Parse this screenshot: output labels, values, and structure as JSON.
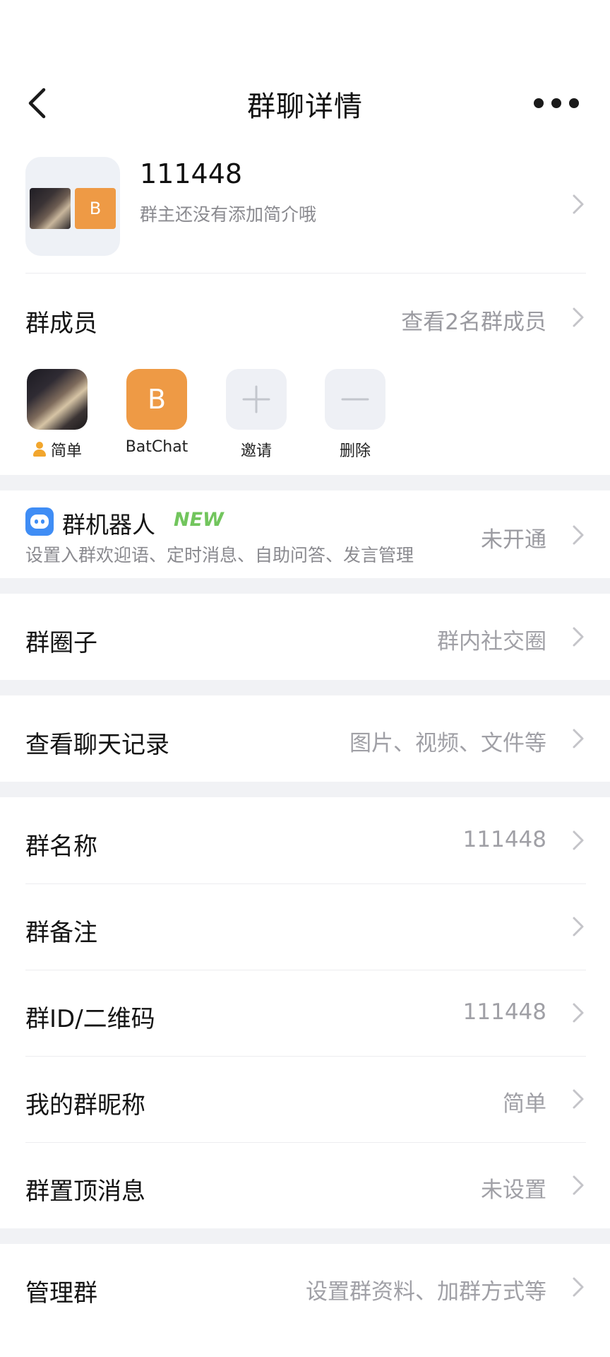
{
  "nav": {
    "title": "群聊详情"
  },
  "group": {
    "name": "111448",
    "intro": "群主还没有添加简介哦",
    "avatar_letter": "B"
  },
  "members": {
    "label": "群成员",
    "view_all": "查看2名群成员",
    "list": [
      {
        "name": "简单"
      },
      {
        "name": "BatChat",
        "letter": "B"
      }
    ],
    "invite_label": "邀请",
    "delete_label": "删除"
  },
  "robot": {
    "title": "群机器人",
    "badge": "NEW",
    "desc": "设置入群欢迎语、定时消息、自助问答、发言管理",
    "status": "未开通"
  },
  "circle": {
    "label": "群圈子",
    "value": "群内社交圈"
  },
  "history": {
    "label": "查看聊天记录",
    "value": "图片、视频、文件等"
  },
  "settings": [
    {
      "label": "群名称",
      "value": "111448"
    },
    {
      "label": "群备注",
      "value": ""
    },
    {
      "label": "群ID/二维码",
      "value": "111448"
    },
    {
      "label": "我的群昵称",
      "value": "简单"
    },
    {
      "label": "群置顶消息",
      "value": "未设置"
    }
  ],
  "manage": {
    "label": "管理群",
    "value": "设置群资料、加群方式等"
  },
  "colors": {
    "accent_orange": "#ee9a45",
    "new_green": "#72c55d",
    "robot_blue": "#3f8df5",
    "divider_bg": "#f1f2f5"
  },
  "icons": [
    "back-icon",
    "more-icon",
    "chevron-right-icon",
    "person-icon",
    "robot-icon",
    "plus-icon",
    "minus-icon"
  ]
}
